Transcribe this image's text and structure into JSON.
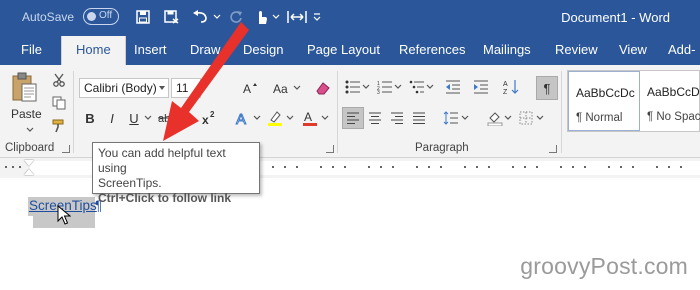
{
  "titlebar": {
    "autosave_label": "AutoSave",
    "autosave_state": "Off",
    "document_title": "Document1 - Word"
  },
  "tabs": [
    {
      "label": "File"
    },
    {
      "label": "Home"
    },
    {
      "label": "Insert"
    },
    {
      "label": "Draw"
    },
    {
      "label": "Design"
    },
    {
      "label": "Page Layout"
    },
    {
      "label": "References"
    },
    {
      "label": "Mailings"
    },
    {
      "label": "Review"
    },
    {
      "label": "View"
    },
    {
      "label": "Add-"
    }
  ],
  "ribbon": {
    "clipboard": {
      "paste_label": "Paste",
      "group_label": "Clipboard"
    },
    "font": {
      "name": "Calibri (Body)",
      "size": "11"
    },
    "paragraph": {
      "group_label": "Paragraph"
    },
    "styles": [
      {
        "sample": "AaBbCcDc",
        "name": "¶ Normal"
      },
      {
        "sample": "AaBbCcDc",
        "name": "¶ No Spac"
      }
    ]
  },
  "tooltip": {
    "line1": "You can add helpful text using",
    "line2": "ScreenTips.",
    "line3": "Ctrl+Click to follow link"
  },
  "document": {
    "link_text": "ScreenTips",
    "pilcrow": "¶"
  },
  "watermark": "groovyPost.com",
  "colors": {
    "titlebar": "#2b579a",
    "ribbon": "#f3f3f3",
    "arrow": "#e8312a",
    "link": "#1f4e9e"
  }
}
